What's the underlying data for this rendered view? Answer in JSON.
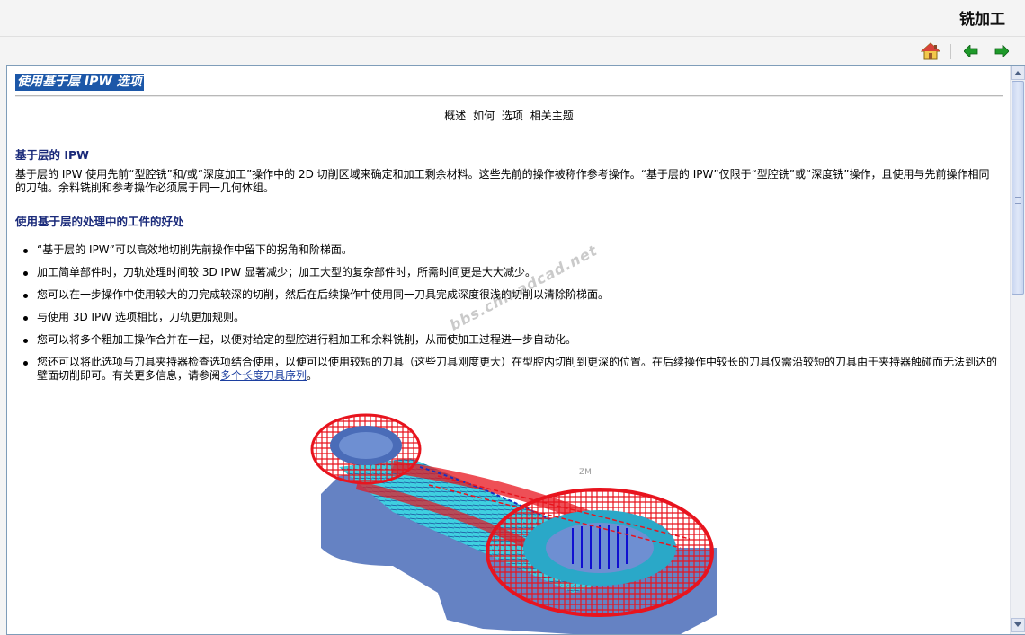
{
  "header": {
    "title": "铣加工"
  },
  "nav": {
    "home_icon": "home-icon",
    "back_icon": "back-arrow-icon",
    "forward_icon": "forward-arrow-icon"
  },
  "page": {
    "title": "使用基于层 IPW 选项",
    "topic_links": [
      "概述",
      "如何",
      "选项",
      "相关主题"
    ],
    "section1": {
      "heading": "基于层的 IPW",
      "text": "基于层的 IPW 使用先前“型腔铣”和/或“深度加工”操作中的 2D 切削区域来确定和加工剩余材料。这些先前的操作被称作参考操作。“基于层的 IPW”仅限于“型腔铣”或“深度铣”操作，且使用与先前操作相同的刀轴。余料铣削和参考操作必须属于同一几何体组。"
    },
    "section2": {
      "heading": "使用基于层的处理中的工件的好处",
      "bullets": [
        "“基于层的 IPW”可以高效地切削先前操作中留下的拐角和阶梯面。",
        "加工简单部件时，刀轨处理时间较 3D IPW 显著减少；加工大型的复杂部件时，所需时间更是大大减少。",
        "您可以在一步操作中使用较大的刀完成较深的切削，然后在后续操作中使用同一刀具完成深度很浅的切削以清除阶梯面。",
        "与使用 3D IPW 选项相比，刀轨更加规则。",
        "您可以将多个粗加工操作合并在一起，以便对给定的型腔进行粗加工和余料铣削，从而使加工过程进一步自动化。"
      ],
      "last_bullet_text": "您还可以将此选项与刀具夹持器检查选项结合使用，以便可以使用较短的刀具（这些刀具刚度更大）在型腔内切削到更深的位置。在后续操作中较长的刀具仅需沿较短的刀具由于夹持器触碰而无法到达的壁面切削即可。有关更多信息，请参阅",
      "last_bullet_link": "多个长度刀具序列",
      "last_bullet_end": "。"
    },
    "figure": {
      "axis_label": "ZM"
    },
    "watermark": "bbs.chinadcad.net"
  },
  "colors": {
    "title_highlight": "#1c57a8",
    "heading": "#1a2a7a",
    "link": "#1c3fa0",
    "toolpath_red": "#e8141e",
    "toolpath_cyan": "#3fd0e0",
    "part_blue": "#4a6cb8"
  }
}
